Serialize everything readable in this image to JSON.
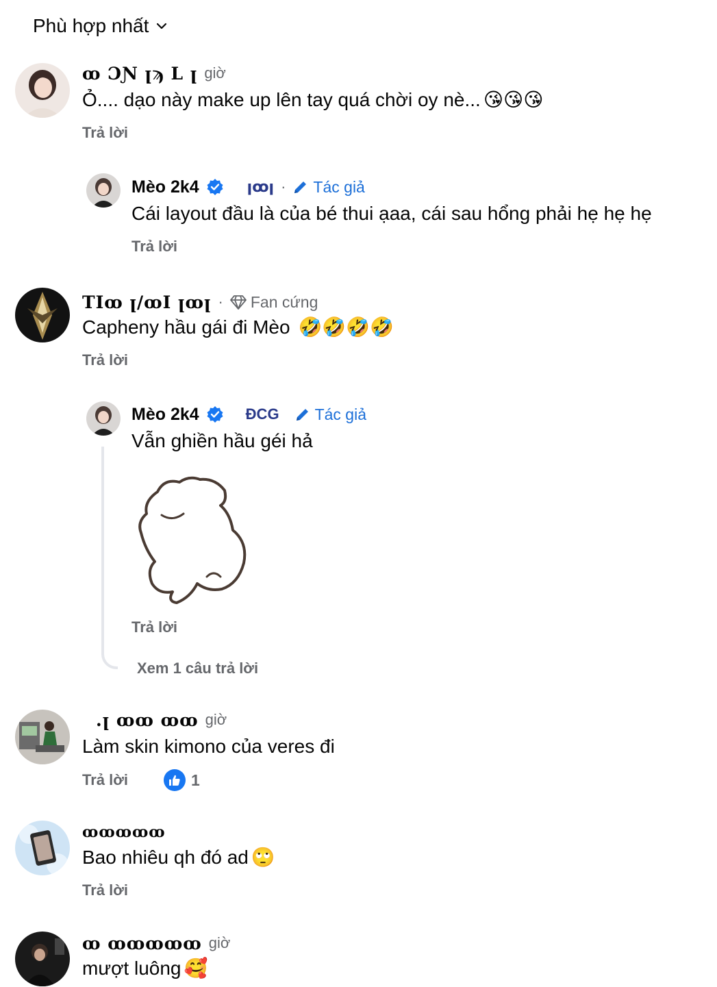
{
  "sort": {
    "label": "Phù hợp nhất"
  },
  "comments": [
    {
      "name": "ꝏ ƆƝ  ꞁϡ  L  ꞁ",
      "time": "giờ",
      "text": "Ỏ.... dạo này make up lên tay quá chời oy nè...",
      "emojis": "😘😘😘",
      "reply_label": "Trả lời"
    },
    {
      "name": "Mèo 2k4",
      "time": "ꞁꝏꞁ",
      "separator": "·",
      "badge": "Tác giả",
      "text": "Cái layout đầu là của bé thui ạaa, cái sau hổng phải hẹ hẹ hẹ",
      "reply_label": "Trả lời"
    },
    {
      "name": "TIꝏ ꞁ/ꝏI ꞁꝏꞁ",
      "separator": "·",
      "badge": "Fan cứng",
      "text": "Capheny hầu gái đi Mèo",
      "emojis": "🤣🤣🤣🤣",
      "reply_label": "Trả lời"
    },
    {
      "name": "Mèo 2k4",
      "time": "ĐCG",
      "badge": "Tác giả",
      "text": "Vẫn ghiền hầu géi hả",
      "reply_label": "Trả lời",
      "view_replies": "Xem 1 câu trả lời"
    },
    {
      "name": ".ꞁ ꝏꝏ ꝏꝏ",
      "time": "giờ",
      "text": "Làm skin kimono của veres đi",
      "reply_label": "Trả lời",
      "likes": "1"
    },
    {
      "name": "ꝏꝏꝏꝏꝏ",
      "text": "Bao nhiêu qh đó ad",
      "emojis": "🙄",
      "reply_label": "Trả lời"
    },
    {
      "name": "ꝏ ꝏꝏꝏꝏꝏ",
      "time": "giờ",
      "text": "mượt luông",
      "emojis": "🥰"
    }
  ]
}
